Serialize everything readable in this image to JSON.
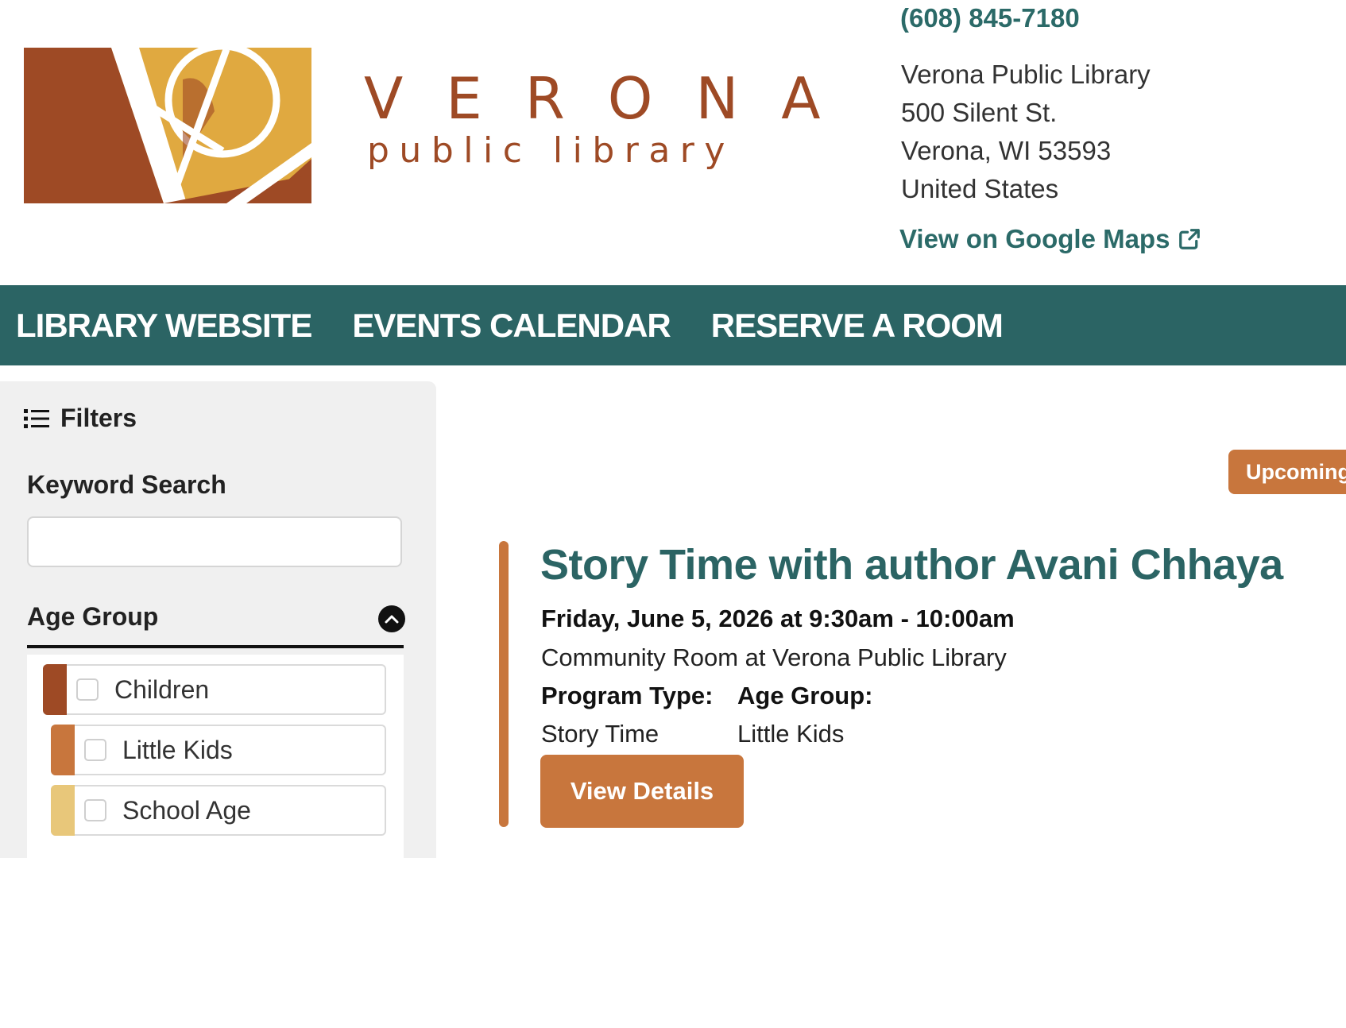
{
  "header": {
    "logo_word": "VERONA",
    "logo_subword": "public library",
    "phone": "(608) 845-7180",
    "address": [
      "Verona Public Library",
      "500 Silent St.",
      "Verona, WI 53593",
      "United States"
    ],
    "maps_link": "View on Google Maps"
  },
  "nav": {
    "items": [
      "LIBRARY WEBSITE",
      "EVENTS CALENDAR",
      "RESERVE A ROOM"
    ]
  },
  "sidebar": {
    "filters_title": "Filters",
    "keyword_label": "Keyword Search",
    "keyword_value": "",
    "age_group_title": "Age Group",
    "age_groups": [
      {
        "label": "Children",
        "color": "#9e4a25"
      },
      {
        "label": "Little Kids",
        "color": "#c8763d"
      },
      {
        "label": "School Age",
        "color": "#e8c77a"
      }
    ]
  },
  "main": {
    "upcoming_label": "Upcoming",
    "event": {
      "title": "Story Time with author Avani Chhaya",
      "date": "Friday, June 5, 2026 at 9:30am - 10:00am",
      "location": "Community Room at Verona Public Library",
      "program_type_label": "Program Type:",
      "program_type_value": "Story Time",
      "age_group_label": "Age Group:",
      "age_group_value": "Little Kids",
      "details_button": "View Details"
    }
  },
  "colors": {
    "teal": "#2b6464",
    "orange": "#c8763d",
    "brown": "#9e4a25",
    "gold": "#e0a940"
  }
}
